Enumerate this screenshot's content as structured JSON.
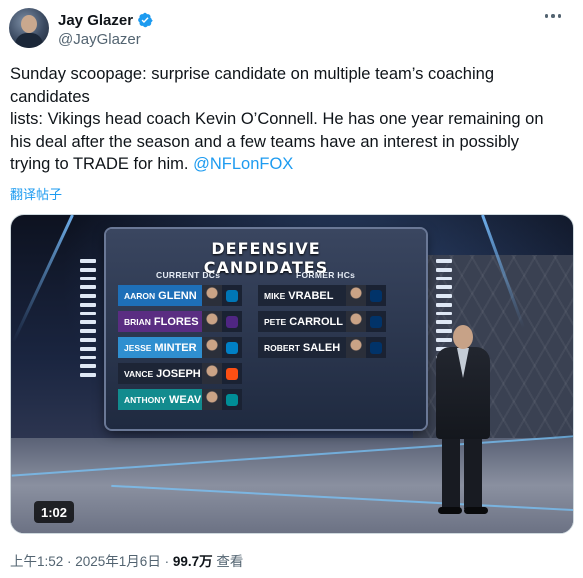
{
  "author": {
    "display_name": "Jay Glazer",
    "handle": "@JayGlazer",
    "verified_color": "#1d9bf0"
  },
  "menu_icon": "more-horizontal-icon",
  "tweet": {
    "text_lines": [
      "Sunday scoopage: surprise candidate on multiple team’s coaching",
      "candidates",
      "lists: Vikings head coach Kevin O’Connell. He has one year remaining on",
      "his deal after the season and a few teams have an interest in possibly"
    ],
    "text_last_prefix": "trying to TRADE for him. ",
    "mention": "@NFLonFOX",
    "translate_label": "翻译帖子"
  },
  "media": {
    "duration": "1:02",
    "board": {
      "title": "DEFENSIVE CANDIDATES",
      "left_header": "CURRENT DCs",
      "right_header": "FORMER HCs",
      "current_dcs": [
        {
          "first": "AARON",
          "last": "GLENN",
          "bar_color": "#1e6fb8",
          "logo_color": "#0076b6"
        },
        {
          "first": "BRIAN",
          "last": "FLORES",
          "bar_color": "#5a2d82",
          "logo_color": "#4f2683"
        },
        {
          "first": "JESSE",
          "last": "MINTER",
          "bar_color": "#2f8fd0",
          "logo_color": "#0080c6"
        },
        {
          "first": "VANCE",
          "last": "JOSEPH",
          "bar_color": "#1d2536",
          "logo_color": "#fb4f14"
        },
        {
          "first": "ANTHONY",
          "last": "WEAVER",
          "bar_color": "#128b8e",
          "logo_color": "#008e97"
        }
      ],
      "former_hcs": [
        {
          "first": "MIKE",
          "last": "VRABEL",
          "bar_color": "#1d2536",
          "logo_color": "#013369"
        },
        {
          "first": "PETE",
          "last": "CARROLL",
          "bar_color": "#1d2536",
          "logo_color": "#013369"
        },
        {
          "first": "ROBERT",
          "last": "SALEH",
          "bar_color": "#1d2536",
          "logo_color": "#013369"
        }
      ]
    }
  },
  "footer": {
    "timestamp": "上午1:52 · 2025年1月6日 · ",
    "views": "99.7万",
    "views_suffix": " 查看"
  }
}
